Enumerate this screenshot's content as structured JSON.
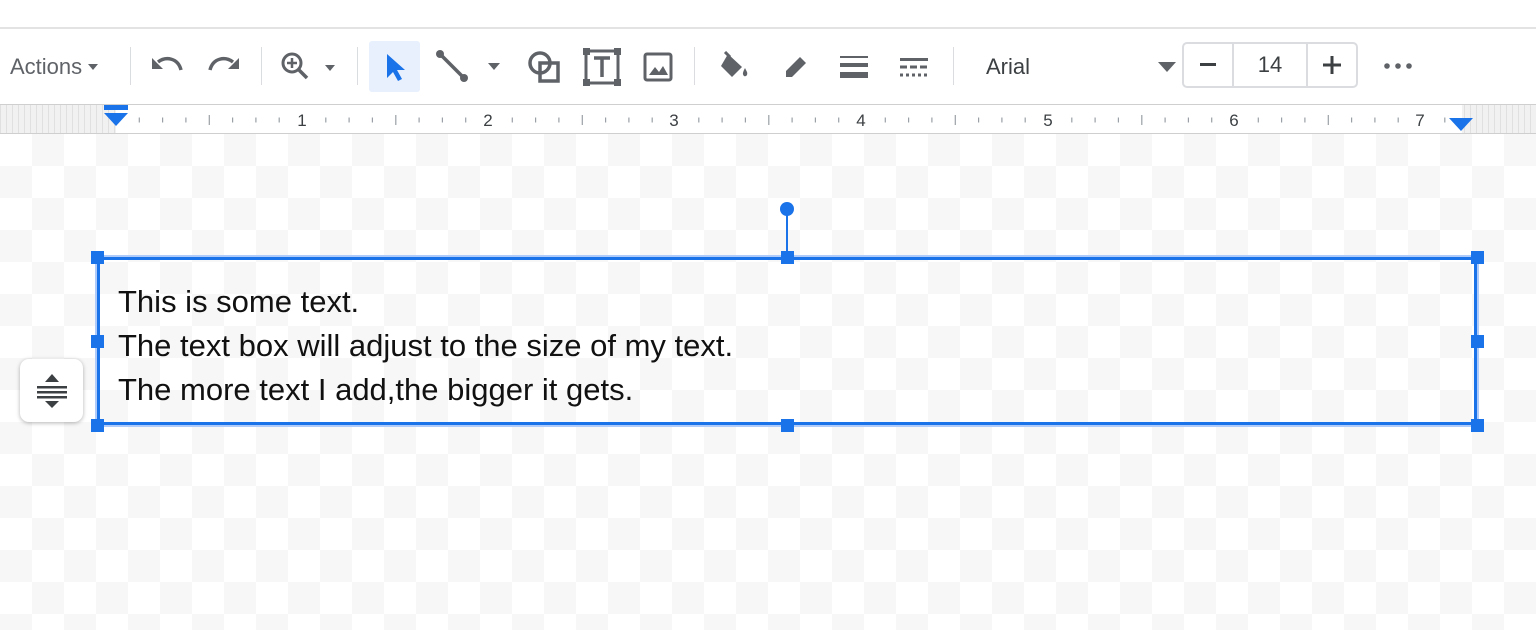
{
  "toolbar": {
    "actions_label": "Actions",
    "font_name": "Arial",
    "font_size": "14"
  },
  "ruler": {
    "labels": [
      "1",
      "2",
      "3",
      "4",
      "5",
      "6",
      "7"
    ]
  },
  "textbox": {
    "lines": [
      "This is some text.",
      "The text box will adjust to the size of my text.",
      "The more text I add,the bigger it gets."
    ]
  },
  "icons": {
    "undo": "undo-icon",
    "redo": "redo-icon",
    "zoom": "zoom-icon",
    "select": "select-cursor-icon",
    "line": "line-icon",
    "shape": "shape-icon",
    "textbox": "text-box-icon",
    "image": "image-icon",
    "fill": "fill-color-icon",
    "pen": "border-color-icon",
    "weight": "border-weight-icon",
    "dash": "border-dash-icon",
    "more": "more-icon",
    "vertical_align": "vertical-align-icon"
  },
  "colors": {
    "accent": "#1a73e8",
    "icon": "#5f6368"
  }
}
